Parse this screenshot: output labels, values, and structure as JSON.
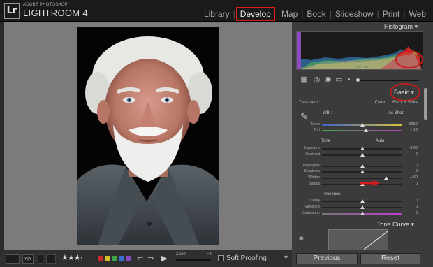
{
  "app": {
    "logo": "Lr",
    "brand_small": "ADOBE PHOTOSHOP",
    "brand_big": "LIGHTROOM 4"
  },
  "modules": [
    "Library",
    "Develop",
    "Map",
    "Book",
    "Slideshow",
    "Print",
    "Web"
  ],
  "active_module": "Develop",
  "colors": {
    "accent_red": "#e21b1b",
    "panel_bg": "#3b3b3b",
    "view_bg": "#7b7b7b"
  },
  "histogram": {
    "title": "Histogram",
    "iso": "ISO 100",
    "shutter": "1/60 sec",
    "aperture": "f / 2.8"
  },
  "basic": {
    "title": "Basic",
    "treatment_label": "Treatment :",
    "treatment_color": "Color",
    "treatment_bw": "Black & White",
    "wb_label": "WB :",
    "wb_value": "As Shot",
    "temp_label": "Temp",
    "temp_value": "6350",
    "tint_label": "Tint",
    "tint_value": "+ 13",
    "tone_label": "Tone",
    "auto_label": "Auto",
    "exposure_label": "Exposure",
    "exposure_value": "0.00",
    "contrast_label": "Contrast",
    "contrast_value": "0",
    "highlights_label": "Highlights",
    "highlights_value": "0",
    "shadows_label": "Shadows",
    "shadows_value": "0",
    "whites_label": "Whites",
    "whites_value": "+ 60",
    "blacks_label": "Blacks",
    "blacks_value": "0",
    "presence_label": "Presence",
    "clarity_label": "Clarity",
    "clarity_value": "0",
    "vibrance_label": "Vibrance",
    "vibrance_value": "0",
    "saturation_label": "Saturation",
    "saturation_value": "0"
  },
  "tone_curve": {
    "title": "Tone Curve"
  },
  "buttons": {
    "previous": "Previous",
    "reset": "Reset"
  },
  "toolbar": {
    "zoom_label": "Zoom",
    "fit_label": "Fit",
    "soft_proofing": "Soft Proofing",
    "stars": "★★★·"
  },
  "sliders": {
    "temp": 0.5,
    "tint": 0.55,
    "exposure": 0.5,
    "contrast": 0.5,
    "highlights": 0.5,
    "shadows": 0.5,
    "whites": 0.8,
    "blacks": 0.5,
    "clarity": 0.5,
    "vibrance": 0.5,
    "saturation": 0.5
  }
}
